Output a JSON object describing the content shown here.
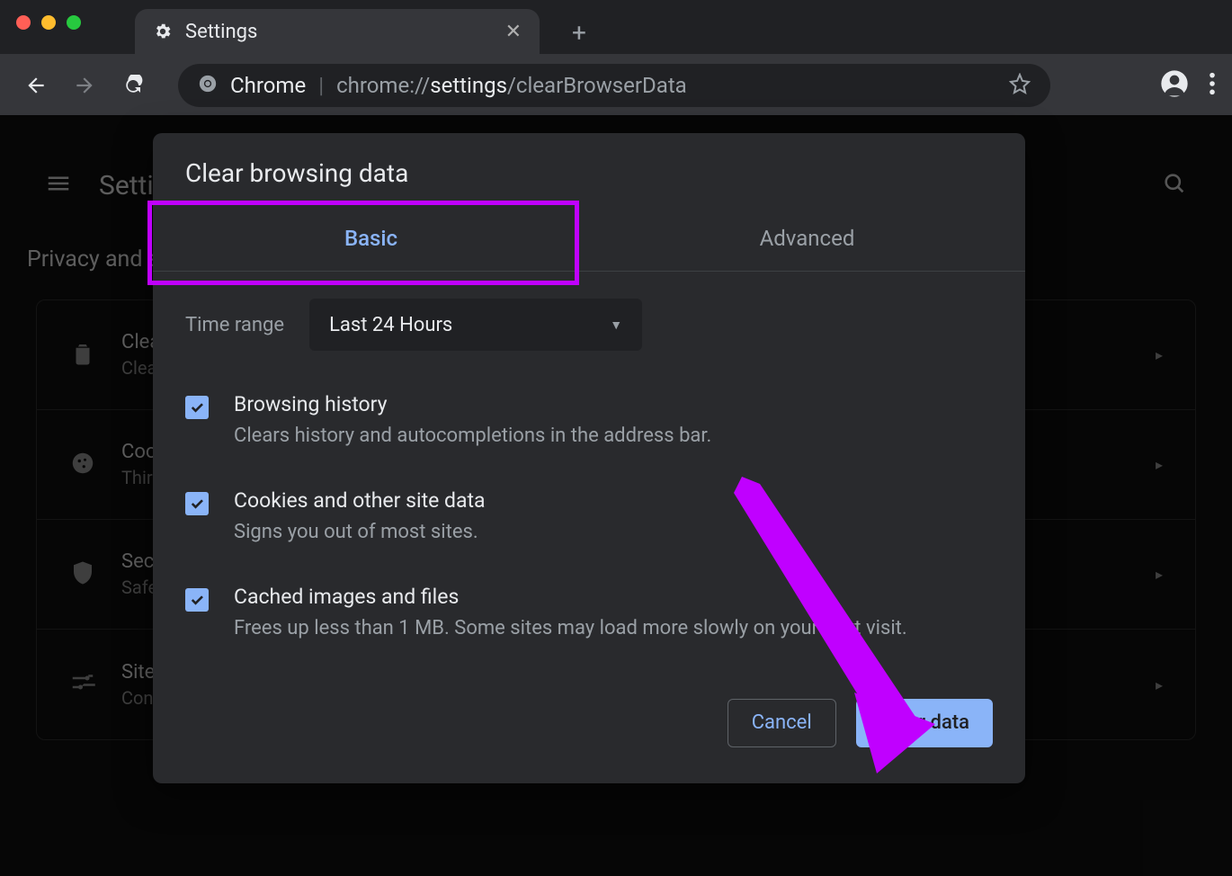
{
  "window": {
    "tab_label": "Settings"
  },
  "omnibox": {
    "prefix": "Chrome",
    "url_dim1": "chrome://",
    "url_bold": "settings",
    "url_dim2": "/clearBrowserData"
  },
  "page": {
    "app_title": "Settings",
    "section_title": "Privacy and security",
    "rows": [
      {
        "t1": "Clear browsing data",
        "t2": "Clear history, cookies, cache, and more"
      },
      {
        "t1": "Cookies and other site data",
        "t2": "Third-party cookies are blocked in Incognito mode"
      },
      {
        "t1": "Security",
        "t2": "Safe Browsing (protection from dangerous sites) and other security settings"
      },
      {
        "t1": "Site Settings",
        "t2": "Controls what information sites can use and show"
      }
    ]
  },
  "dialog": {
    "title": "Clear browsing data",
    "tabs": {
      "basic": "Basic",
      "advanced": "Advanced"
    },
    "time_range_label": "Time range",
    "time_range_value": "Last 24 Hours",
    "items": [
      {
        "title": "Browsing history",
        "desc": "Clears history and autocompletions in the address bar."
      },
      {
        "title": "Cookies and other site data",
        "desc": "Signs you out of most sites."
      },
      {
        "title": "Cached images and files",
        "desc": "Frees up less than 1 MB. Some sites may load more slowly on your next visit."
      }
    ],
    "cancel": "Cancel",
    "clear": "Clear data"
  }
}
